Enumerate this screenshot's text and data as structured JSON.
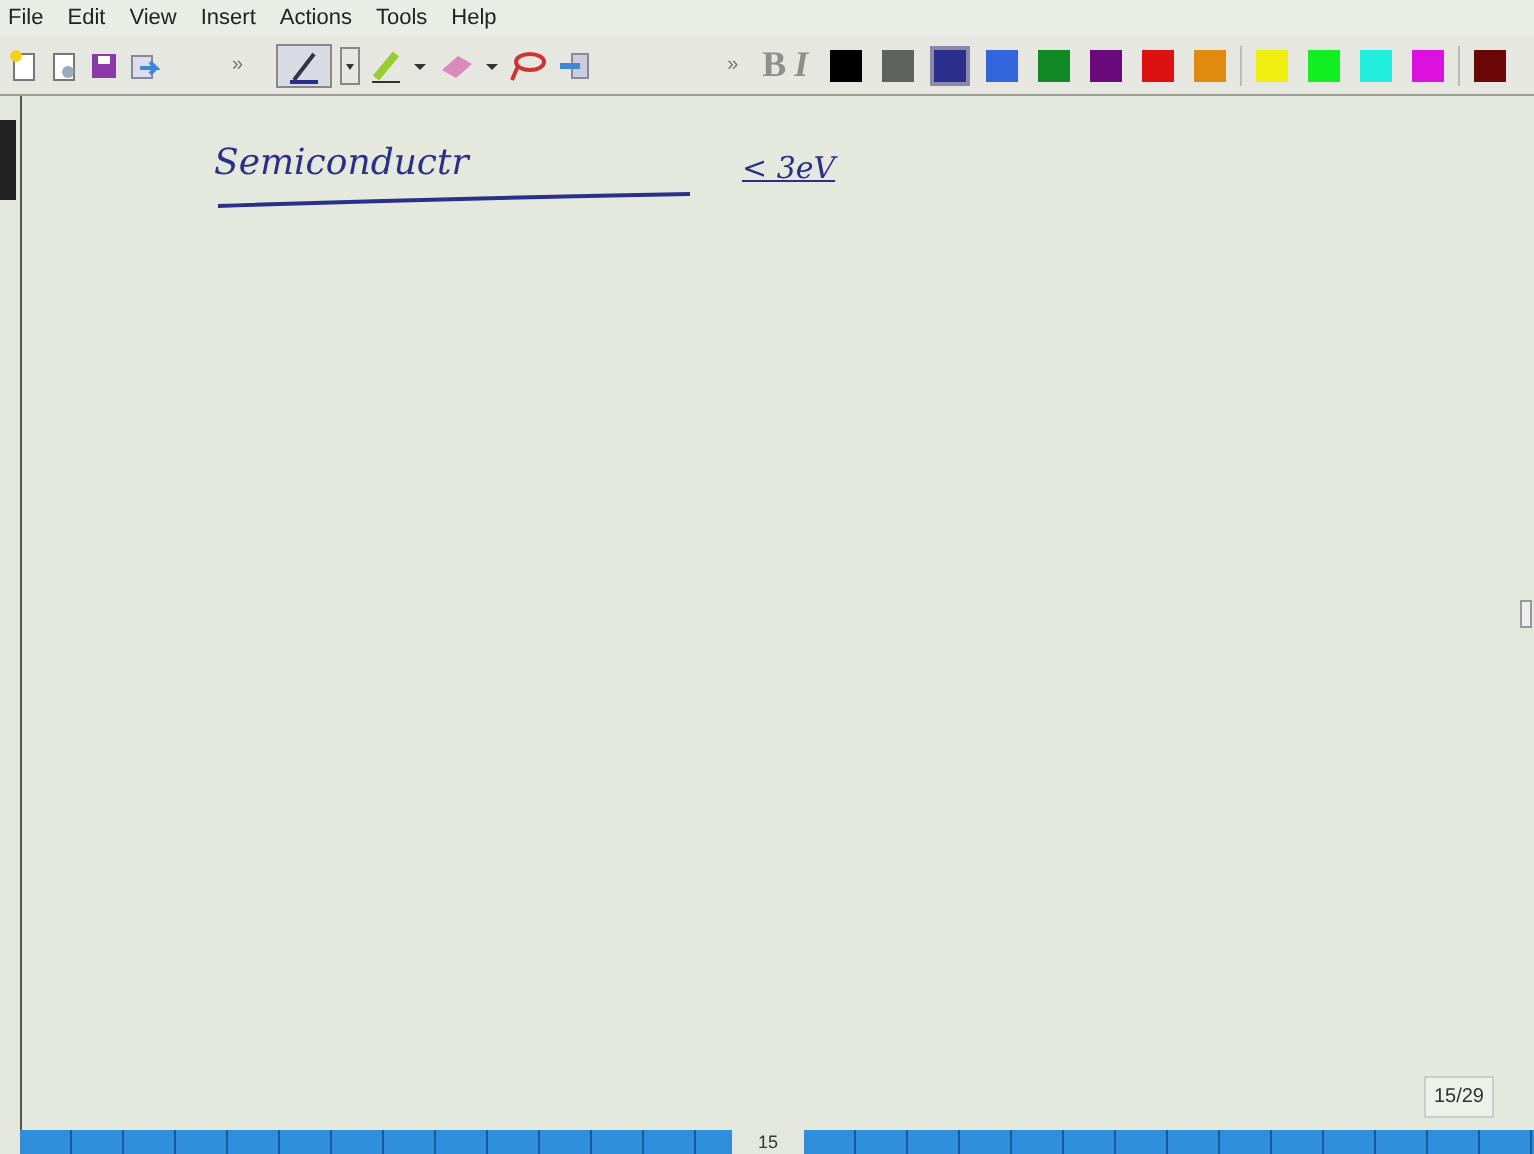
{
  "menu": [
    "File",
    "Edit",
    "View",
    "Insert",
    "Actions",
    "Tools",
    "Help"
  ],
  "toolbar": {
    "overflow": "»",
    "pen_selected": true,
    "bold": "B",
    "italic": "I"
  },
  "colors": [
    {
      "color": "#000000",
      "selected": false
    },
    {
      "color": "#5f615e",
      "selected": false
    },
    {
      "color": "#2b2e8a",
      "selected": true
    },
    {
      "color": "#3366dd",
      "selected": false
    },
    {
      "color": "#118822",
      "selected": false
    },
    {
      "color": "#6a0a7a",
      "selected": false
    },
    {
      "color": "#dd1111",
      "selected": false
    },
    {
      "color": "#e08a10",
      "selected": false
    },
    {
      "color": "#eeee11",
      "selected": false
    },
    {
      "color": "#11ee22",
      "selected": false
    },
    {
      "color": "#22eedd",
      "selected": false
    },
    {
      "color": "#dd11dd",
      "selected": false
    },
    {
      "color": "#6a0808",
      "selected": false
    }
  ],
  "ink": {
    "word": "Semiconductr",
    "relation": "< 3eV"
  },
  "page_counter": "15/29",
  "page_tab": "15"
}
